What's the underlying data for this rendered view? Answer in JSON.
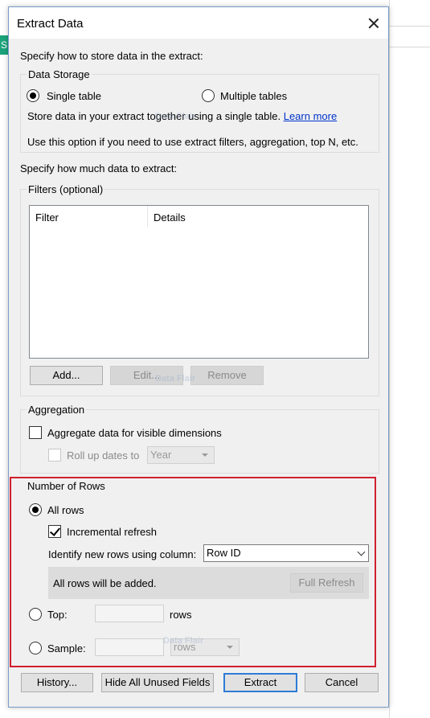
{
  "background": {
    "left_tab": "S"
  },
  "dialog": {
    "title": "Extract Data",
    "intro": "Specify how to store data in the extract:",
    "data_storage": {
      "group_label": "Data Storage",
      "single_table": "Single table",
      "multiple_tables": "Multiple tables",
      "selected": "Single table",
      "desc_text": "Store data in your extract together using a single table.",
      "learn_more": "Learn more",
      "hint": "Use this option if you need to use extract filters, aggregation, top N, etc."
    },
    "how_much": "Specify how much data to extract:",
    "filters": {
      "group_label": "Filters (optional)",
      "columns": [
        "Filter",
        "Details"
      ],
      "rows": [],
      "add": "Add...",
      "edit": "Edit...",
      "remove": "Remove"
    },
    "aggregation": {
      "group_label": "Aggregation",
      "aggregate_label": "Aggregate data for visible dimensions",
      "aggregate_checked": false,
      "rollup_label": "Roll up dates to",
      "rollup_value": "Year"
    },
    "rows": {
      "group_label": "Number of Rows",
      "all_rows": "All rows",
      "incremental": "Incremental refresh",
      "incremental_checked": true,
      "identify_label": "Identify new rows using column:",
      "identify_value": "Row ID",
      "info": "All rows will be added.",
      "full_refresh": "Full Refresh",
      "top_label": "Top:",
      "top_value": "",
      "top_unit": "rows",
      "sample_label": "Sample:",
      "sample_value": "",
      "sample_unit": "rows",
      "selected": "All rows"
    },
    "footer": {
      "history": "History...",
      "hide_unused": "Hide All Unused Fields",
      "extract": "Extract",
      "cancel": "Cancel"
    },
    "watermark": "Data Flair",
    "colors": {
      "highlight": "#d0202e",
      "default_button_border": "#2e7bd6",
      "link": "#0033cc"
    }
  }
}
